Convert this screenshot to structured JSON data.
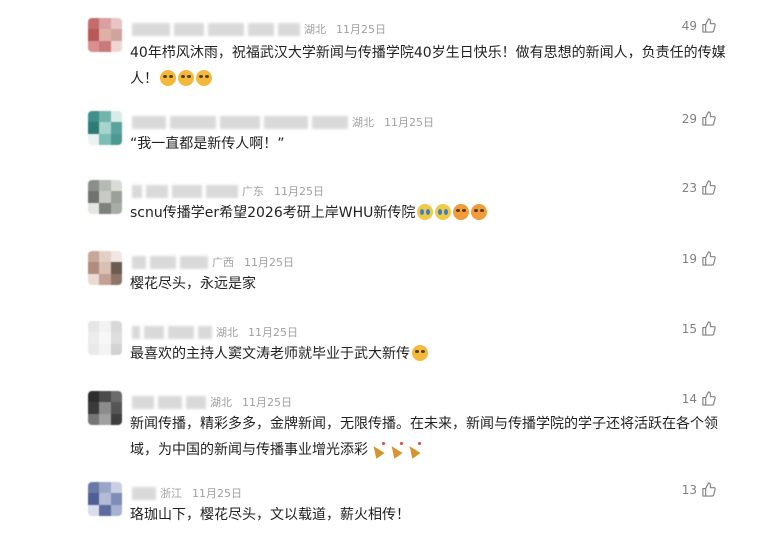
{
  "comments": [
    {
      "location": "湖北",
      "date": "11月25日",
      "likes": "49",
      "text": "40年栉风沐雨，祝福武汉大学新闻与传播学院40岁生日快乐！做有思想的新闻人，负责任的传媒人！",
      "emojis": [
        "grin",
        "grin",
        "grin"
      ],
      "avatar_colors": [
        "#c46b6b",
        "#d9a0a0",
        "#e8c4c4",
        "#b85757",
        "#e0b0a8",
        "#cfa39e",
        "#d98f8f",
        "#c87a7a",
        "#efd6d0"
      ]
    },
    {
      "location": "湖北",
      "date": "11月25日",
      "likes": "29",
      "text": "“我一直都是新传人啊！”",
      "emojis": [],
      "avatar_colors": [
        "#3f8f8a",
        "#6fb4ad",
        "#d7ece9",
        "#2f7a74",
        "#a8d3ce",
        "#5aa39c",
        "#e9f3f2",
        "#7cbdb6",
        "#4c9993"
      ]
    },
    {
      "location": "广东",
      "date": "11月25日",
      "likes": "23",
      "text": "scnu传播学er希望2026考研上岸WHU新传院",
      "emojis": [
        "cry",
        "cry",
        "cheer",
        "cheer"
      ],
      "avatar_colors": [
        "#8a8f8a",
        "#b6bab4",
        "#d9dcd6",
        "#6f746e",
        "#c8cbc5",
        "#9aa09a",
        "#e4e6e1",
        "#7d827c",
        "#a7aca6"
      ]
    },
    {
      "location": "广西",
      "date": "11月25日",
      "likes": "19",
      "text": "樱花尽头，永远是家",
      "emojis": [],
      "avatar_colors": [
        "#c7a79a",
        "#e3cfc6",
        "#f1e6e1",
        "#b08b7e",
        "#d9c0b5",
        "#6d5a52",
        "#e9dad3",
        "#c2a093",
        "#8f7569"
      ]
    },
    {
      "location": "湖北",
      "date": "11月25日",
      "likes": "15",
      "text": "最喜欢的主持人窦文涛老师就毕业于武大新传",
      "emojis": [
        "grin"
      ],
      "avatar_colors": [
        "#e6e6e6",
        "#f2f2f2",
        "#d8d8d8",
        "#ececec",
        "#f7f7f7",
        "#dedede",
        "#e9e9e9",
        "#f4f4f4",
        "#d2d2d2"
      ]
    },
    {
      "location": "湖北",
      "date": "11月25日",
      "likes": "14",
      "text": "新闻传播，精彩多多，金牌新闻，无限传播。在未来，新闻与传播学院的学子还将活跃在各个领域，为中国的新闻与传播事业增光添彩",
      "emojis": [
        "party",
        "party",
        "party"
      ],
      "avatar_colors": [
        "#2e2e2e",
        "#4a4a4a",
        "#6b6b6b",
        "#3a3a3a",
        "#8c8c8c",
        "#555555",
        "#767676",
        "#a0a0a0",
        "#3f3f3f"
      ]
    },
    {
      "location": "浙江",
      "date": "11月25日",
      "likes": "13",
      "text": "珞珈山下，樱花尽头，文以载道，薪火相传！",
      "emojis": [],
      "avatar_colors": [
        "#6a78a8",
        "#9aa5c9",
        "#c9cfe3",
        "#4f5f93",
        "#b3bbd7",
        "#7f8cb7",
        "#d9dded",
        "#5d6c9e",
        "#a6b0d0"
      ]
    }
  ]
}
